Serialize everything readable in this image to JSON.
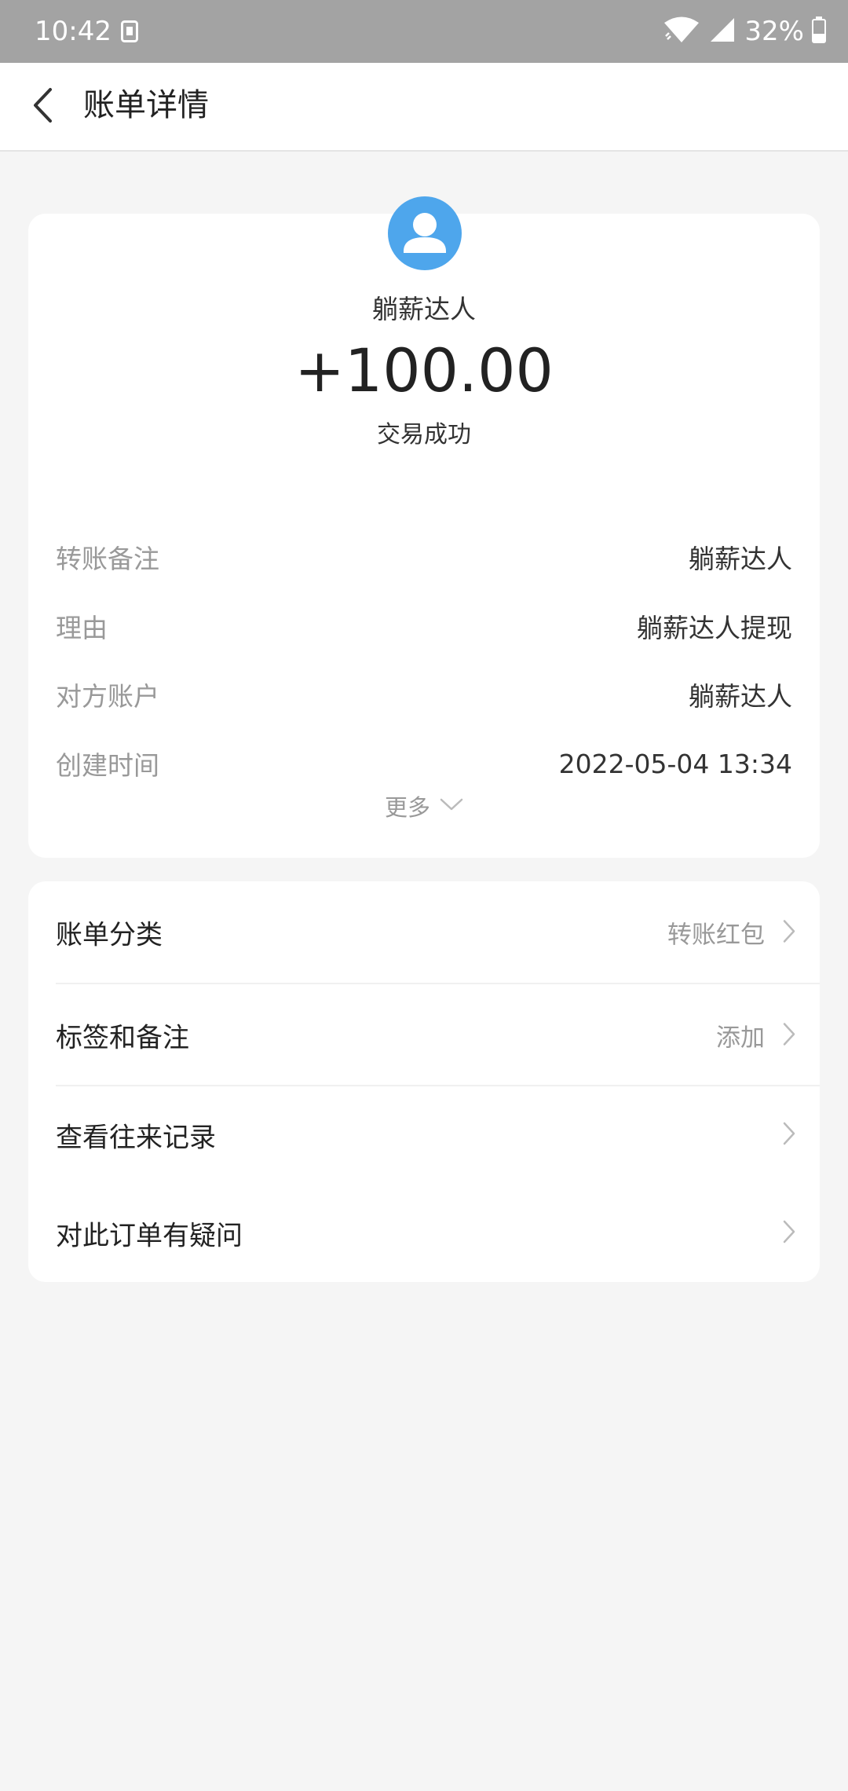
{
  "status_bar": {
    "time": "10:42",
    "battery_text": "32%"
  },
  "header": {
    "title": "账单详情"
  },
  "summary": {
    "payee": "躺薪达人",
    "amount": "+100.00",
    "status": "交易成功"
  },
  "details": [
    {
      "label": "转账备注",
      "value": "躺薪达人"
    },
    {
      "label": "理由",
      "value": "躺薪达人提现"
    },
    {
      "label": "对方账户",
      "value": "躺薪达人"
    },
    {
      "label": "创建时间",
      "value": "2022-05-04 13:34"
    }
  ],
  "more_label": "更多",
  "menu": [
    {
      "label": "账单分类",
      "value": "转账红包"
    },
    {
      "label": "标签和备注",
      "value": "添加"
    },
    {
      "label": "查看往来记录",
      "value": ""
    },
    {
      "label": "对此订单有疑问",
      "value": ""
    }
  ],
  "colors": {
    "status_bar": "#a3a3a3",
    "avatar": "#4ea6ec",
    "background": "#f5f5f5"
  }
}
